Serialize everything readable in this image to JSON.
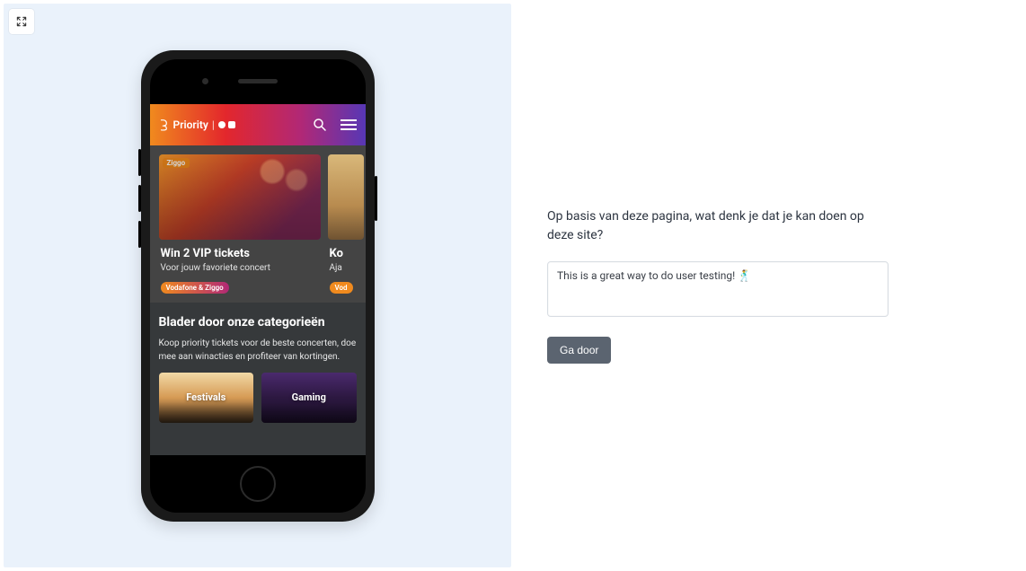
{
  "left": {
    "app": {
      "brand": "Priority",
      "hero_cards": [
        {
          "badge": "Ziggo",
          "title": "Win 2 VIP tickets",
          "subtitle": "Voor jouw favoriete concert",
          "chip": "Vodafone & Ziggo"
        },
        {
          "title_fragment": "Ko",
          "subtitle_fragment": "Aja",
          "chip_fragment": "Vod"
        }
      ],
      "categories": {
        "heading": "Blader door onze categorieën",
        "body": "Koop priority tickets voor de beste concerten, doe mee aan winacties en profiteer van kortingen.",
        "items": [
          "Festivals",
          "Gaming"
        ]
      }
    }
  },
  "right": {
    "question": "Op basis van deze pagina, wat denk je dat je kan doen op deze site?",
    "answer_value": "This is a great way to do user testing! 🕺",
    "continue_label": "Ga door"
  }
}
